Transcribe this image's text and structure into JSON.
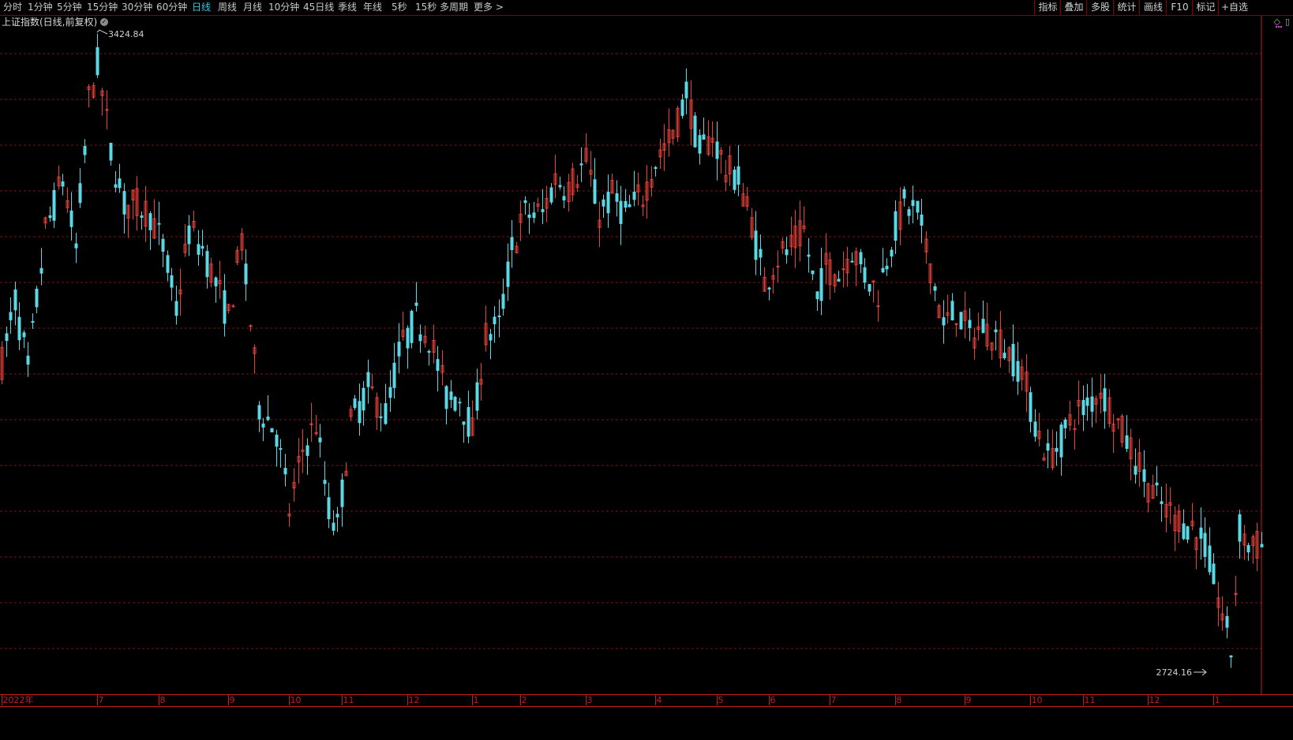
{
  "toolbar": {
    "timeframes": [
      "分时",
      "1分钟",
      "5分钟",
      "15分钟",
      "30分钟",
      "60分钟",
      "日线",
      "周线",
      "月线",
      "10分钟",
      "45日线",
      "季线",
      "年线",
      "5秒",
      "15秒",
      "多周期",
      "更多 >"
    ],
    "active_timeframe": "日线",
    "buttons": [
      "指标",
      "叠加",
      "多股",
      "统计",
      "画线",
      "F10",
      "标记",
      "+自选"
    ]
  },
  "header": {
    "title": "上证指数(日线,前复权)",
    "right_icons": [
      "diamond-icon",
      "window-icon"
    ]
  },
  "colors": {
    "background": "#000000",
    "up": "#e8413a",
    "down": "#5ad8e6",
    "grid": "#7a1515",
    "axis": "#c81e1e",
    "text": "#c8c8c8",
    "active_tab": "#3cc3e6"
  },
  "chart_data": {
    "type": "candlestick",
    "title": "上证指数(日线,前复权)",
    "annotations": {
      "high": "3424.84",
      "low": "2724.16"
    },
    "ylim": [
      2690,
      3450
    ],
    "x_tick_labels": [
      {
        "label": "2022年",
        "index": 0
      },
      {
        "label": "7",
        "index": 22
      },
      {
        "label": "8",
        "index": 36
      },
      {
        "label": "9",
        "index": 52
      },
      {
        "label": "10",
        "index": 66
      },
      {
        "label": "11",
        "index": 78
      },
      {
        "label": "12",
        "index": 93
      },
      {
        "label": "1",
        "index": 108
      },
      {
        "label": "2",
        "index": 119
      },
      {
        "label": "3",
        "index": 134
      },
      {
        "label": "4",
        "index": 150
      },
      {
        "label": "5",
        "index": 164
      },
      {
        "label": "6",
        "index": 176
      },
      {
        "label": "7",
        "index": 190
      },
      {
        "label": "8",
        "index": 205
      },
      {
        "label": "9",
        "index": 221
      },
      {
        "label": "10",
        "index": 236
      },
      {
        "label": "11",
        "index": 248
      },
      {
        "label": "12",
        "index": 263
      },
      {
        "label": "1",
        "index": 278
      }
    ],
    "points": [
      [
        0,
        3070
      ],
      [
        3,
        3140
      ],
      [
        6,
        3060
      ],
      [
        10,
        3220
      ],
      [
        14,
        3280
      ],
      [
        17,
        3200
      ],
      [
        20,
        3370
      ],
      [
        22,
        3410
      ],
      [
        25,
        3310
      ],
      [
        28,
        3250
      ],
      [
        31,
        3250
      ],
      [
        34,
        3240
      ],
      [
        37,
        3200
      ],
      [
        40,
        3130
      ],
      [
        43,
        3220
      ],
      [
        46,
        3200
      ],
      [
        49,
        3160
      ],
      [
        52,
        3120
      ],
      [
        55,
        3210
      ],
      [
        59,
        3020
      ],
      [
        63,
        2990
      ],
      [
        66,
        2900
      ],
      [
        69,
        2970
      ],
      [
        72,
        3000
      ],
      [
        75,
        2900
      ],
      [
        77,
        2880
      ],
      [
        80,
        3000
      ],
      [
        84,
        3040
      ],
      [
        88,
        3010
      ],
      [
        91,
        3080
      ],
      [
        95,
        3120
      ],
      [
        98,
        3100
      ],
      [
        102,
        3030
      ],
      [
        105,
        3030
      ],
      [
        108,
        2990
      ],
      [
        111,
        3100
      ],
      [
        114,
        3110
      ],
      [
        117,
        3200
      ],
      [
        120,
        3240
      ],
      [
        124,
        3240
      ],
      [
        127,
        3280
      ],
      [
        130,
        3270
      ],
      [
        134,
        3300
      ],
      [
        137,
        3240
      ],
      [
        140,
        3260
      ],
      [
        143,
        3240
      ],
      [
        147,
        3260
      ],
      [
        150,
        3300
      ],
      [
        154,
        3330
      ],
      [
        157,
        3380
      ],
      [
        160,
        3310
      ],
      [
        163,
        3330
      ],
      [
        166,
        3290
      ],
      [
        169,
        3280
      ],
      [
        172,
        3230
      ],
      [
        175,
        3160
      ],
      [
        178,
        3190
      ],
      [
        181,
        3200
      ],
      [
        184,
        3220
      ],
      [
        187,
        3140
      ],
      [
        189,
        3180
      ],
      [
        192,
        3170
      ],
      [
        195,
        3200
      ],
      [
        198,
        3170
      ],
      [
        201,
        3150
      ],
      [
        204,
        3210
      ],
      [
        207,
        3250
      ],
      [
        210,
        3240
      ],
      [
        213,
        3180
      ],
      [
        216,
        3110
      ],
      [
        219,
        3130
      ],
      [
        222,
        3100
      ],
      [
        225,
        3110
      ],
      [
        228,
        3100
      ],
      [
        231,
        3080
      ],
      [
        234,
        3060
      ],
      [
        237,
        3000
      ],
      [
        240,
        2960
      ],
      [
        243,
        2980
      ],
      [
        246,
        3010
      ],
      [
        249,
        3020
      ],
      [
        252,
        3040
      ],
      [
        255,
        3010
      ],
      [
        258,
        2980
      ],
      [
        261,
        2950
      ],
      [
        264,
        2920
      ],
      [
        267,
        2900
      ],
      [
        270,
        2890
      ],
      [
        273,
        2880
      ],
      [
        276,
        2860
      ],
      [
        279,
        2800
      ],
      [
        281,
        2760
      ],
      [
        282,
        2740
      ],
      [
        284,
        2880
      ],
      [
        286,
        2860
      ]
    ]
  }
}
